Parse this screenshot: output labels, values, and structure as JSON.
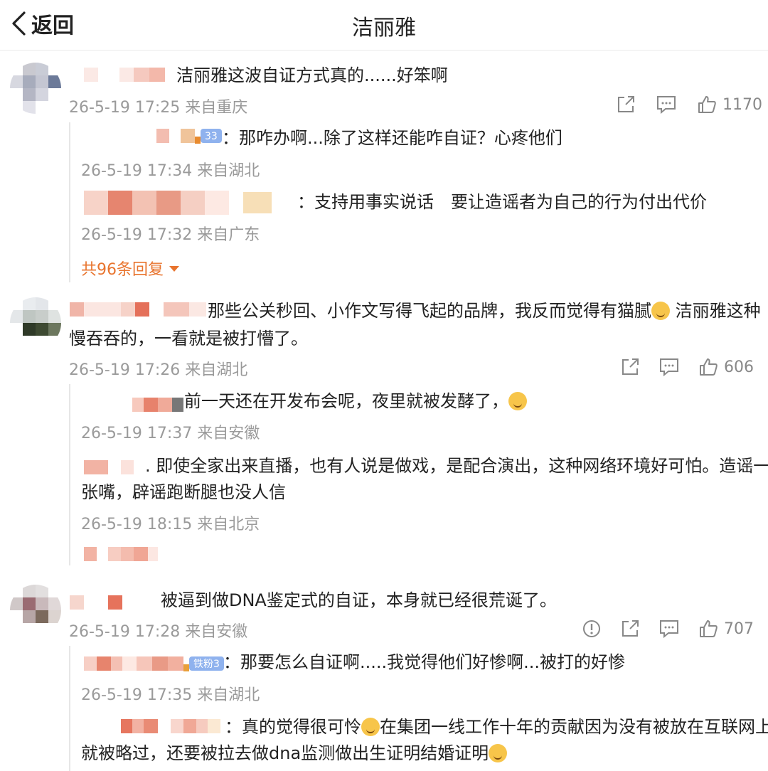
{
  "header": {
    "back_label": "返回",
    "title": "洁丽雅"
  },
  "comments": [
    {
      "text": "洁丽雅这波自证方式真的......好笨啊",
      "meta": "26-5-19 17:25 来自重庆",
      "likes": "1170",
      "replies": [
        {
          "text": "：那咋办啊...除了这样还能咋自证？心疼他们",
          "badge": "33",
          "meta": "26-5-19 17:34 来自湖北"
        },
        {
          "text": "：支持用事实说话　要让造谣者为自己的行为付出代价",
          "meta": "26-5-19 17:32 来自广东"
        }
      ],
      "more_label": "共96条回复"
    },
    {
      "text_line1": "那些公关秒回、小作文写得飞起的品牌，我反而觉得有猫腻",
      "text_line1_tail": " 洁丽雅这种",
      "text_line2": "慢吞吞的，一看就是被打懵了。",
      "meta": "26-5-19 17:26 来自湖北",
      "likes": "606",
      "replies": [
        {
          "text": "前一天还在开发布会呢，夜里就被发酵了，",
          "meta": "26-5-19 17:37 来自安徽"
        },
        {
          "text_line1": ". 即使全家出来直播，也有人说是做戏，是配合演出，这种网络环境好可怕。造谣一",
          "text_line2": "张嘴，辟谣跑断腿也没人信",
          "meta": "26-5-19 18:15 来自北京"
        }
      ]
    },
    {
      "text": "被逼到做DNA鉴定式的自证，本身就已经很荒诞了。",
      "meta": "26-5-19 17:28 来自安徽",
      "likes": "707",
      "replies": [
        {
          "text": "：那要怎么自证啊.....我觉得他们好惨啊...被打的好惨",
          "badge": "铁粉3",
          "meta": "26-5-19 17:35 来自湖北"
        },
        {
          "text_line1": "：真的觉得很可怜",
          "text_line1_tail": "在集团一线工作十年的贡献因为没有被放在互联网上",
          "text_line2": "就被略过，还要被拉去做dna监测做出生证明结婚证明"
        }
      ]
    }
  ],
  "colors": {
    "accent": "#e8742e",
    "meta": "#9a9a9a",
    "blur_pink": "#f2c3b8",
    "blur_red": "#e6775f"
  },
  "icons": [
    "chevron-left-icon",
    "share-icon",
    "comment-icon",
    "like-icon",
    "report-icon",
    "caret-down-icon",
    "emoji-icon"
  ]
}
